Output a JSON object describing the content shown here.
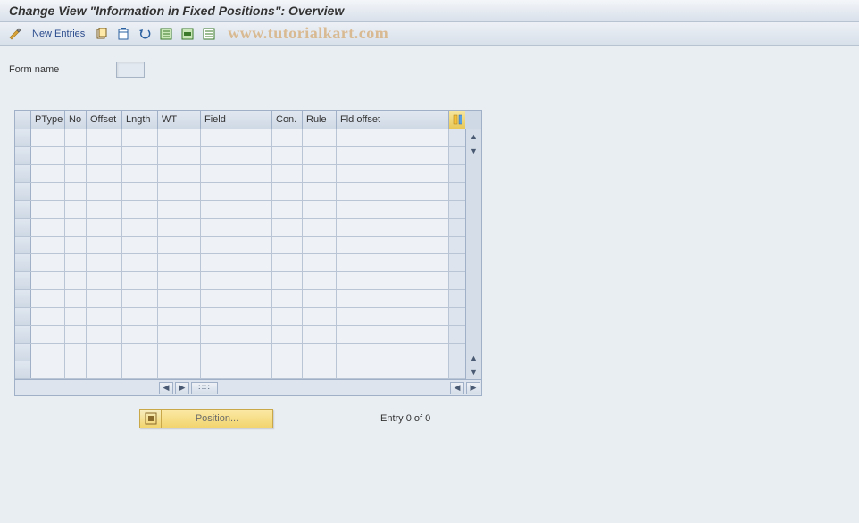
{
  "title": "Change View \"Information in Fixed Positions\": Overview",
  "toolbar": {
    "new_entries": "New Entries"
  },
  "watermark": "www.tutorialkart.com",
  "form": {
    "label": "Form name",
    "value": ""
  },
  "table": {
    "columns": [
      "PType",
      "No",
      "Offset",
      "Lngth",
      "WT",
      "Field",
      "Con.",
      "Rule",
      "Fld offset"
    ],
    "row_count": 14
  },
  "footer": {
    "position_btn": "Position...",
    "entry_text": "Entry 0 of 0"
  }
}
